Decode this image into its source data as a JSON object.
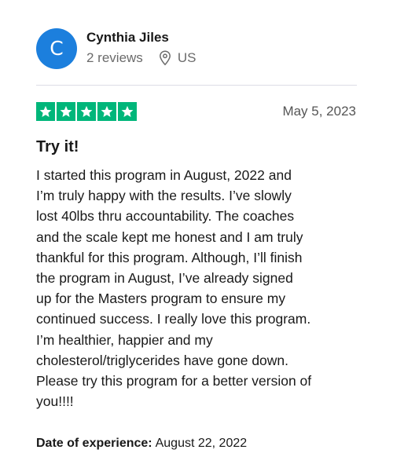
{
  "reviewer": {
    "initial": "C",
    "name": "Cynthia Jiles",
    "reviews_count": "2 reviews",
    "location": "US"
  },
  "review": {
    "rating": 5,
    "date": "May 5, 2023",
    "title": "Try it!",
    "body_lines": [
      "I started this program in August, 2022 and",
      "I’m truly happy with the results. I’ve slowly",
      "lost 40lbs thru accountability. The coaches",
      "and the scale kept me honest and I am truly",
      "thankful for this program. Although, I’ll finish",
      "the program in August, I’ve already signed",
      "up for the Masters program to ensure my",
      "continued success. I really love this program.",
      "I’m healthier, happier and my",
      "cholesterol/triglycerides have gone down.",
      "Please try this program for a better version of",
      "you!!!!"
    ],
    "experience_label": "Date of experience:",
    "experience_date": "August 22, 2022"
  },
  "icons": {
    "location": "location-pin-icon",
    "star": "star-icon"
  },
  "colors": {
    "avatar": "#1c7fdd",
    "star_fill": "#00b67a",
    "star_glyph": "#ffffff",
    "muted_text": "#6b6b6b"
  }
}
